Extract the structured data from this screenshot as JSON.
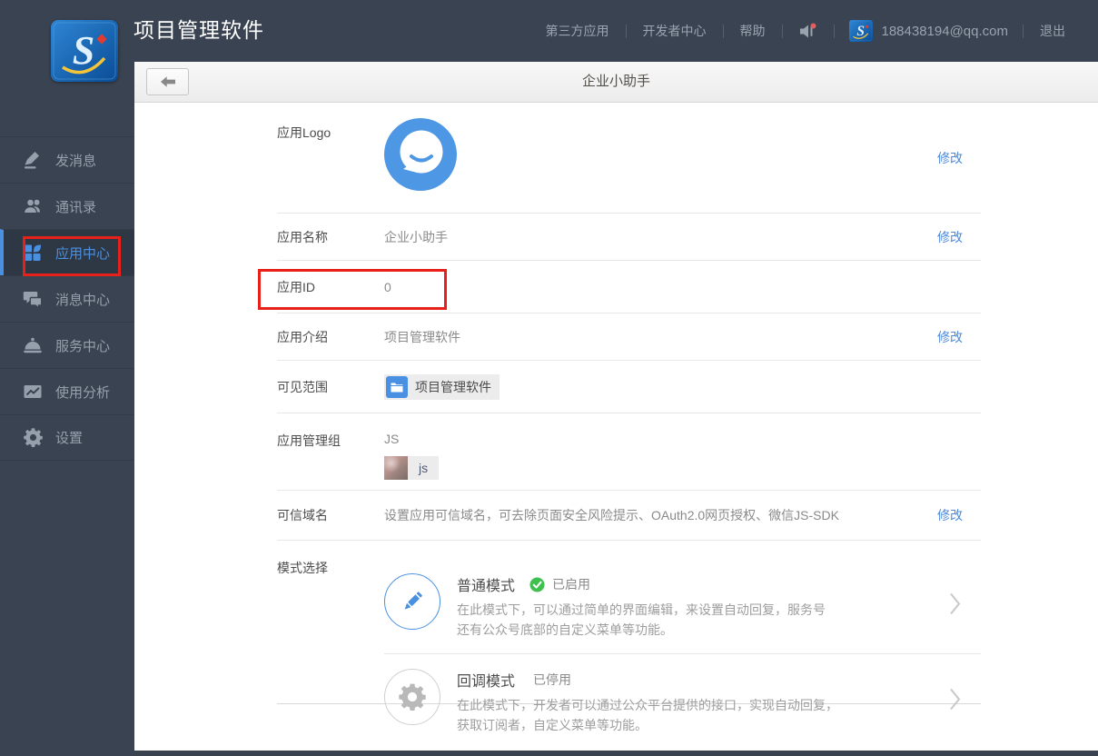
{
  "header": {
    "app_title": "项目管理软件",
    "nav": [
      {
        "label": "第三方应用"
      },
      {
        "label": "开发者中心"
      },
      {
        "label": "帮助"
      }
    ],
    "email": "188438194@qq.com",
    "logout_label": "退出"
  },
  "sidebar": {
    "items": [
      {
        "label": "发消息"
      },
      {
        "label": "通讯录"
      },
      {
        "label": "应用中心",
        "active": true
      },
      {
        "label": "消息中心"
      },
      {
        "label": "服务中心"
      },
      {
        "label": "使用分析"
      },
      {
        "label": "设置"
      }
    ]
  },
  "page": {
    "title": "企业小助手"
  },
  "form": {
    "modify_label": "修改",
    "rows": {
      "logo": {
        "label": "应用Logo"
      },
      "name": {
        "label": "应用名称",
        "value": "企业小助手"
      },
      "id": {
        "label": "应用ID",
        "value": "0"
      },
      "intro": {
        "label": "应用介绍",
        "value": "项目管理软件"
      },
      "scope": {
        "label": "可见范围",
        "tag": "项目管理软件"
      },
      "admin": {
        "label": "应用管理组",
        "group_name": "JS",
        "member_name": "js"
      },
      "trusted": {
        "label": "可信域名",
        "value": "设置应用可信域名，可去除页面安全风险提示、OAuth2.0网页授权、微信JS-SDK"
      },
      "mode": {
        "label": "模式选择",
        "normal": {
          "title": "普通模式",
          "status": "已启用",
          "desc1": "在此模式下，可以通过简单的界面编辑，来设置自动回复，服务号",
          "desc2": "还有公众号底部的自定义菜单等功能。"
        },
        "callback": {
          "title": "回调模式",
          "status": "已停用",
          "desc1": "在此模式下，开发者可以通过公众平台提供的接口，实现自动回复，",
          "desc2": "获取订阅者，自定义菜单等功能。"
        }
      }
    }
  },
  "colors": {
    "header_bg": "#3a4351",
    "accent_blue": "#4a90e2",
    "link_blue": "#4c88d9",
    "status_green": "#3fbf4e",
    "annotation_red": "#e8201a"
  }
}
